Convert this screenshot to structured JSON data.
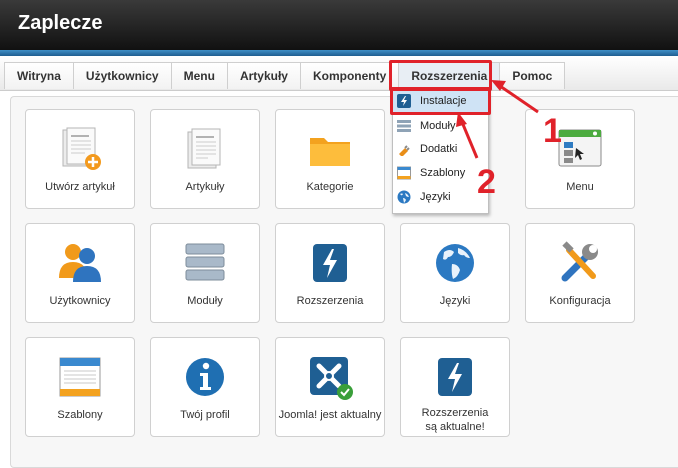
{
  "header": {
    "title": "Zaplecze"
  },
  "menu": {
    "items": [
      {
        "label": "Witryna"
      },
      {
        "label": "Użytkownicy"
      },
      {
        "label": "Menu"
      },
      {
        "label": "Artykuły"
      },
      {
        "label": "Komponenty"
      },
      {
        "label": "Rozszerzenia"
      },
      {
        "label": "Pomoc"
      }
    ]
  },
  "dropdown": {
    "items": [
      {
        "label": "Instalacje",
        "icon": "install-icon"
      },
      {
        "label": "Moduły",
        "icon": "modules-icon"
      },
      {
        "label": "Dodatki",
        "icon": "plugins-icon"
      },
      {
        "label": "Szablony",
        "icon": "templates-icon"
      },
      {
        "label": "Języki",
        "icon": "languages-icon"
      }
    ]
  },
  "tiles": {
    "add_article": "Utwórz artykuł",
    "articles": "Artykuły",
    "categories": "Kategorie",
    "menu": "Menu",
    "users": "Użytkownicy",
    "modules": "Moduły",
    "extensions": "Rozszerzenia",
    "languages": "Języki",
    "configuration": "Konfiguracja",
    "templates": "Szablony",
    "profile": "Twój profil",
    "joomla_uptodate": "Joomla! jest aktualny",
    "ext_uptodate_1": "Rozszerzenia",
    "ext_uptodate_2": "są aktualne!"
  },
  "annotations": {
    "step1": "1",
    "step2": "2"
  },
  "colors": {
    "accent_blue": "#1f6fb2",
    "annotation_red": "#e0222a",
    "header_dark": "#1a1a1a"
  }
}
